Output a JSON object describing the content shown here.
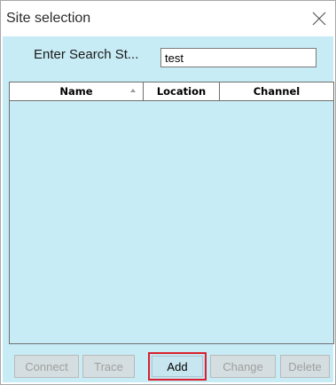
{
  "window": {
    "title": "Site selection",
    "close_icon": "close-icon"
  },
  "search": {
    "label": "Enter Search St...",
    "value": "test"
  },
  "table": {
    "columns": [
      "Name",
      "Location",
      "Channel"
    ],
    "sort_icon": "sort-ascending-icon",
    "rows": []
  },
  "buttons": {
    "connect": "Connect",
    "trace": "Trace",
    "add": "Add",
    "change": "Change",
    "delete": "Delete"
  },
  "colors": {
    "client_background": "#c8ecf6",
    "highlight_border": "#d9202e",
    "disabled_text": "#a0a0a0"
  }
}
